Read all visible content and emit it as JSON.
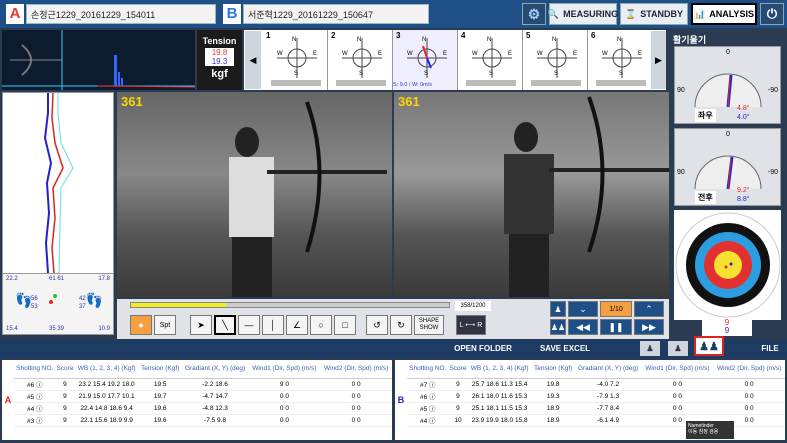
{
  "header": {
    "file_a": "손정근1229_20161229_154011",
    "file_b": "서준혁1229_20161229_150647",
    "measuring_label": "MEASURING",
    "standby_label": "STANDBY",
    "analysis_label": "ANALYSIS",
    "letter_a": "A",
    "letter_b": "B"
  },
  "tension": {
    "title": "Tension",
    "value_a": "19.8",
    "value_b": "19.3",
    "unit": "kgf"
  },
  "compass": {
    "cells": [
      {
        "num": "1",
        "text": ""
      },
      {
        "num": "2",
        "text": ""
      },
      {
        "num": "3",
        "text": "S: 9.0 / W: 0m/s"
      },
      {
        "num": "4",
        "text": ""
      },
      {
        "num": "5",
        "text": ""
      },
      {
        "num": "6",
        "text": ""
      }
    ]
  },
  "side_gauge": {
    "title": "활기울기",
    "g1": {
      "top": "0",
      "left": "90",
      "right": "-90",
      "label": "좌우",
      "val_red": "4.8°",
      "val_blue": "4.0°"
    },
    "g2": {
      "top": "0",
      "left": "90",
      "right": "-90",
      "label": "전후",
      "val_red": "9.2°",
      "val_blue": "8.8°"
    },
    "score_red": "9",
    "score_blue": "9"
  },
  "video": {
    "frame_a": "361",
    "frame_b": "361",
    "counter": "358/1200",
    "speed": "1/10"
  },
  "left_graph": {
    "top_left": "22.2",
    "top_mid": "61 61",
    "top_right": "17.8",
    "mid_left": "56",
    "mid_left2": "53",
    "mid_right": "42",
    "mid_right2": "37",
    "bot_left": "15.4",
    "bot_mid": "35 39",
    "bot_right": "10.9"
  },
  "toolbar": {
    "spt": "Spt",
    "shape_show": "SHAPE\nSHOW",
    "lr": "L ⟷ R"
  },
  "actions": {
    "open_folder": "OPEN FOLDER",
    "save_excel": "SAVE EXCEL",
    "file": "FILE",
    "tooltip": "Nametinder\n이동 침정 검용"
  },
  "table_a": {
    "side_letter": "A",
    "headers": [
      "Shotting NO.",
      "Score",
      "WB (1, 2, 3, 4)\n(Kgf)",
      "Tension\n(Kgf)",
      "Gradiant (X, Y)\n(deg)",
      "Wind1 (Dir, Spd)\n(m/s)",
      "Wind2 (Dir, Spd)\n(m/s)"
    ],
    "rows": [
      {
        "no": "#6",
        "icon": "ⓘ",
        "score": "9",
        "wb": [
          "23.2",
          "15.4",
          "19.2",
          "18.0"
        ],
        "tension": "19.5",
        "grad": [
          "-2.2",
          "18.6"
        ],
        "w1": [
          "9",
          "0"
        ],
        "w2": [
          "0",
          "0"
        ],
        "red": true
      },
      {
        "no": "#5",
        "icon": "ⓘ",
        "score": "9",
        "wb": [
          "21.9",
          "15.0",
          "17.7",
          "10.1"
        ],
        "tension": "19.7",
        "grad": [
          "-4.7",
          "14.7"
        ],
        "w1": [
          "0",
          "0"
        ],
        "w2": [
          "0",
          "0"
        ],
        "red": false
      },
      {
        "no": "#4",
        "icon": "ⓘ",
        "score": "9",
        "wb": [
          "22.4",
          "14.8",
          "18.6",
          "9.4"
        ],
        "tension": "19.6",
        "grad": [
          "-4.8",
          "12.3"
        ],
        "w1": [
          "0",
          "0"
        ],
        "w2": [
          "0",
          "0"
        ],
        "red": false
      },
      {
        "no": "#3",
        "icon": "ⓘ",
        "score": "9",
        "wb": [
          "22.1",
          "15.6",
          "18.9",
          "9.9"
        ],
        "tension": "19.6",
        "grad": [
          "-7.5",
          "9.8"
        ],
        "w1": [
          "0",
          "0"
        ],
        "w2": [
          "0",
          "0"
        ],
        "red": false
      }
    ]
  },
  "table_b": {
    "side_letter": "B",
    "headers": [
      "Shotting NO.",
      "Score",
      "WB (1, 2, 3, 4)\n(Kgf)",
      "Tension\n(Kgf)",
      "Gradiant (X, Y)\n(deg)",
      "Wind1 (Dir, Spd)\n(m/s)",
      "Wind2 (Dir, Spd)\n(m/s)"
    ],
    "rows": [
      {
        "no": "#7",
        "icon": "ⓘ",
        "score": "9",
        "wb": [
          "25.7",
          "18.6",
          "11.3",
          "15.4"
        ],
        "tension": "19.8",
        "grad": [
          "-4.0",
          "7.2"
        ],
        "w1": [
          "0",
          "0"
        ],
        "w2": [
          "0",
          "0"
        ],
        "red": false
      },
      {
        "no": "#6",
        "icon": "ⓘ",
        "score": "9",
        "wb": [
          "26.1",
          "18.0",
          "11.6",
          "15.3"
        ],
        "tension": "19.3",
        "grad": [
          "-7.9",
          "1.3"
        ],
        "w1": [
          "0",
          "0"
        ],
        "w2": [
          "0",
          "0"
        ],
        "red": false
      },
      {
        "no": "#5",
        "icon": "ⓘ",
        "score": "9",
        "wb": [
          "25.1",
          "18.1",
          "11.5",
          "15.3"
        ],
        "tension": "18.9",
        "grad": [
          "-7.7",
          "8.4"
        ],
        "w1": [
          "0",
          "0"
        ],
        "w2": [
          "0",
          "0"
        ],
        "red": false
      },
      {
        "no": "#4",
        "icon": "ⓘ",
        "score": "10",
        "wb": [
          "23.9",
          "19.9",
          "18.0",
          "15.8"
        ],
        "tension": "18.9",
        "grad": [
          "-6.1",
          "4.9"
        ],
        "w1": [
          "0",
          "0"
        ],
        "w2": [
          "0",
          "0"
        ],
        "red": false
      }
    ]
  }
}
